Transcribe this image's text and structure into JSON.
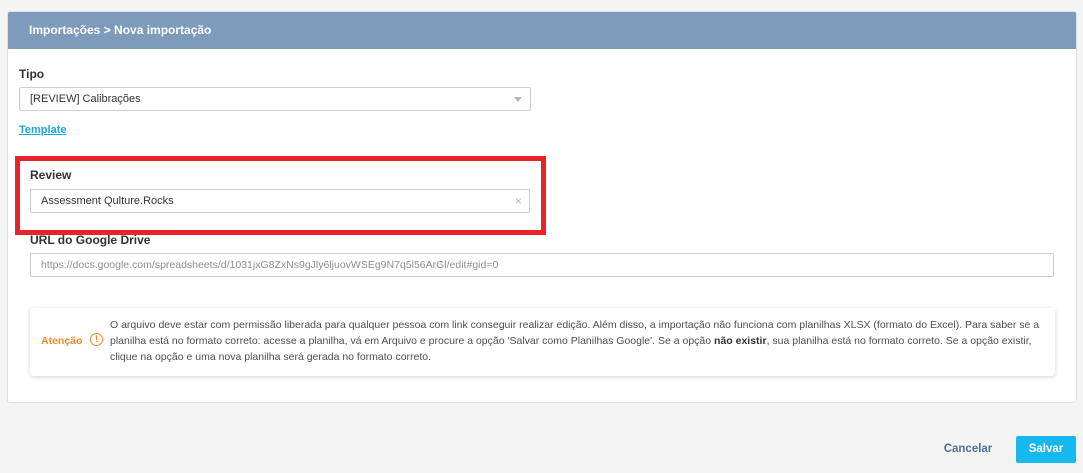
{
  "header": {
    "breadcrumb": "Importações > Nova importação"
  },
  "tipo": {
    "label": "Tipo",
    "selected": "[REVIEW] Calibrações"
  },
  "template_link": "Template",
  "review": {
    "label": "Review",
    "value": "Assessment Qulture.Rocks",
    "clear_symbol": "×"
  },
  "url": {
    "label": "URL do Google Drive",
    "placeholder": "https://docs.google.com/spreadsheets/d/1031jxG8ZxNs9gJly6ljuovWSEg9N7q5l56ArGl/edit#gid=0"
  },
  "alert": {
    "title": "Atenção",
    "icon_symbol": "!",
    "text_part1": "O arquivo deve estar com permissão liberada para qualquer pessoa com link conseguir realizar edição. Além disso, a importação não funciona com planilhas XLSX (formato do Excel). Para saber se a planilha está no formato correto: acesse a planilha, vá em Arquivo e procure a opção 'Salvar como Planilhas Google'. Se a opção ",
    "text_bold": "não existir",
    "text_part2": ", sua planilha está no formato correto. Se a opção existir, clique na opção e uma nova planilha será gerada no formato correto."
  },
  "actions": {
    "cancel_label": "Cancelar",
    "save_label": "Salvar"
  },
  "colors": {
    "header_bg": "#7f9bbc",
    "highlight_border": "#e8232a",
    "link": "#1ba6d9",
    "warning": "#f08a24",
    "primary_button": "#17b8ef",
    "cancel_text": "#4a6fa0"
  }
}
